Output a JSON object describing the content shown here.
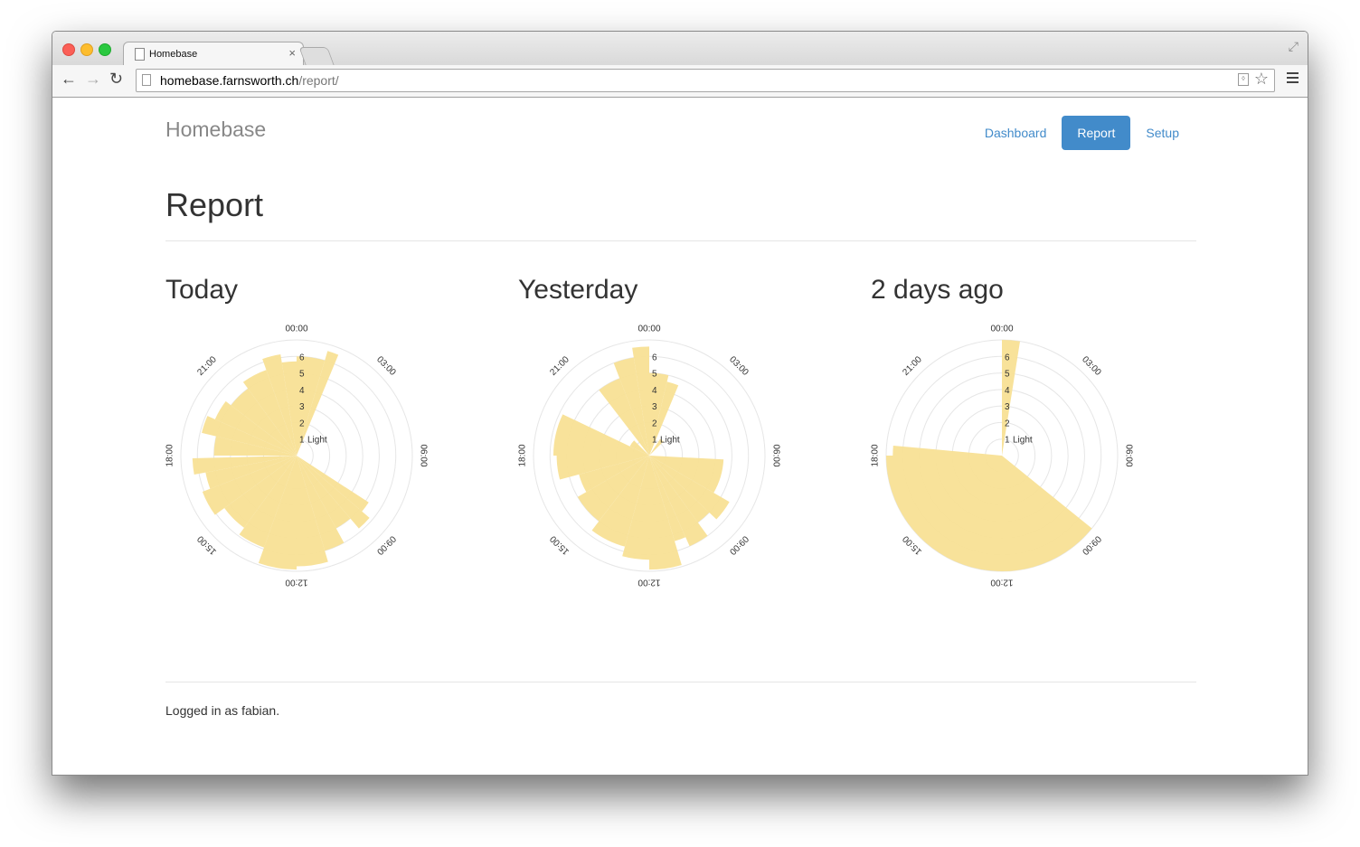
{
  "browser": {
    "tab_title": "Homebase",
    "url_host": "homebase.farnsworth.ch",
    "url_path": "/report/"
  },
  "brand": "Homebase",
  "nav": {
    "items": [
      {
        "label": "Dashboard",
        "active": false
      },
      {
        "label": "Report",
        "active": true
      },
      {
        "label": "Setup",
        "active": false
      }
    ]
  },
  "page_title": "Report",
  "footer": "Logged in as fabian.",
  "colors": {
    "accent": "#428bca",
    "wedge": "#f8e095"
  },
  "chart_data": [
    {
      "type": "polar-area",
      "title": "Today",
      "angle_labels": [
        "00:00",
        "03:00",
        "06:00",
        "09:00",
        "12:00",
        "15:00",
        "18:00",
        "21:00"
      ],
      "radial_ticks": [
        "1",
        "2",
        "3",
        "4",
        "5",
        "6"
      ],
      "radial_range": [
        0,
        7
      ],
      "series_label": "Light",
      "series": [
        {
          "name": "Light",
          "start_hour": 0.0,
          "end_hour": 1.1,
          "value": 6.0
        },
        {
          "name": "Light",
          "start_hour": 1.1,
          "end_hour": 1.5,
          "value": 6.6
        },
        {
          "name": "Light",
          "start_hour": 8.2,
          "end_hour": 8.7,
          "value": 5.2
        },
        {
          "name": "Light",
          "start_hour": 8.7,
          "end_hour": 9.3,
          "value": 5.8
        },
        {
          "name": "Light",
          "start_hour": 9.3,
          "end_hour": 10.1,
          "value": 5.0
        },
        {
          "name": "Light",
          "start_hour": 10.1,
          "end_hour": 10.9,
          "value": 6.0
        },
        {
          "name": "Light",
          "start_hour": 10.9,
          "end_hour": 12.0,
          "value": 6.7
        },
        {
          "name": "Light",
          "start_hour": 12.0,
          "end_hour": 13.3,
          "value": 6.9
        },
        {
          "name": "Light",
          "start_hour": 13.3,
          "end_hour": 14.4,
          "value": 5.9
        },
        {
          "name": "Light",
          "start_hour": 14.4,
          "end_hour": 15.6,
          "value": 5.4
        },
        {
          "name": "Light",
          "start_hour": 15.6,
          "end_hour": 16.6,
          "value": 6.1
        },
        {
          "name": "Light",
          "start_hour": 16.6,
          "end_hour": 17.3,
          "value": 5.6
        },
        {
          "name": "Light",
          "start_hour": 17.3,
          "end_hour": 17.9,
          "value": 6.3
        },
        {
          "name": "Light",
          "start_hour": 18.0,
          "end_hour": 18.9,
          "value": 5.0
        },
        {
          "name": "Light",
          "start_hour": 18.9,
          "end_hour": 19.6,
          "value": 5.9
        },
        {
          "name": "Light",
          "start_hour": 19.6,
          "end_hour": 20.5,
          "value": 5.4
        },
        {
          "name": "Light",
          "start_hour": 20.5,
          "end_hour": 21.6,
          "value": 5.0
        },
        {
          "name": "Light",
          "start_hour": 21.6,
          "end_hour": 22.7,
          "value": 5.5
        },
        {
          "name": "Light",
          "start_hour": 22.7,
          "end_hour": 23.4,
          "value": 6.2
        },
        {
          "name": "Light",
          "start_hour": 23.4,
          "end_hour": 24.0,
          "value": 5.7
        }
      ]
    },
    {
      "type": "polar-area",
      "title": "Yesterday",
      "angle_labels": [
        "00:00",
        "03:00",
        "06:00",
        "09:00",
        "12:00",
        "15:00",
        "18:00",
        "21:00"
      ],
      "radial_ticks": [
        "1",
        "2",
        "3",
        "4",
        "5",
        "6"
      ],
      "radial_range": [
        0,
        7
      ],
      "series_label": "Light",
      "series": [
        {
          "name": "Light",
          "start_hour": 0.0,
          "end_hour": 0.9,
          "value": 5.0
        },
        {
          "name": "Light",
          "start_hour": 0.9,
          "end_hour": 1.5,
          "value": 4.6
        },
        {
          "name": "Light",
          "start_hour": 2.2,
          "end_hour": 3.0,
          "value": 1.2
        },
        {
          "name": "Light",
          "start_hour": 6.2,
          "end_hour": 8.0,
          "value": 4.5
        },
        {
          "name": "Light",
          "start_hour": 8.0,
          "end_hour": 8.9,
          "value": 5.6
        },
        {
          "name": "Light",
          "start_hour": 8.9,
          "end_hour": 9.6,
          "value": 5.0
        },
        {
          "name": "Light",
          "start_hour": 9.6,
          "end_hour": 10.4,
          "value": 6.0
        },
        {
          "name": "Light",
          "start_hour": 10.4,
          "end_hour": 10.9,
          "value": 5.4
        },
        {
          "name": "Light",
          "start_hour": 10.9,
          "end_hour": 12.0,
          "value": 6.9
        },
        {
          "name": "Light",
          "start_hour": 12.0,
          "end_hour": 13.0,
          "value": 6.3
        },
        {
          "name": "Light",
          "start_hour": 13.0,
          "end_hour": 14.5,
          "value": 5.7
        },
        {
          "name": "Light",
          "start_hour": 14.5,
          "end_hour": 16.0,
          "value": 5.0
        },
        {
          "name": "Light",
          "start_hour": 16.0,
          "end_hour": 17.0,
          "value": 4.4
        },
        {
          "name": "Light",
          "start_hour": 17.0,
          "end_hour": 18.0,
          "value": 5.6
        },
        {
          "name": "Light",
          "start_hour": 18.0,
          "end_hour": 19.7,
          "value": 5.8
        },
        {
          "name": "Light",
          "start_hour": 19.7,
          "end_hour": 21.0,
          "value": 1.3
        },
        {
          "name": "Light",
          "start_hour": 21.5,
          "end_hour": 22.6,
          "value": 5.0
        },
        {
          "name": "Light",
          "start_hour": 22.6,
          "end_hour": 23.4,
          "value": 6.0
        },
        {
          "name": "Light",
          "start_hour": 23.4,
          "end_hour": 24.0,
          "value": 6.6
        }
      ]
    },
    {
      "type": "polar-area",
      "title": "2 days ago",
      "angle_labels": [
        "00:00",
        "03:00",
        "06:00",
        "09:00",
        "12:00",
        "15:00",
        "18:00",
        "21:00"
      ],
      "radial_ticks": [
        "1",
        "2",
        "3",
        "4",
        "5",
        "6"
      ],
      "radial_range": [
        0,
        7
      ],
      "series_label": "Light",
      "series": [
        {
          "name": "Light",
          "start_hour": 0.0,
          "end_hour": 0.6,
          "value": 7.0
        },
        {
          "name": "Light",
          "start_hour": 8.6,
          "end_hour": 18.0,
          "value": 7.0
        },
        {
          "name": "Light",
          "start_hour": 18.0,
          "end_hour": 18.35,
          "value": 6.6
        }
      ]
    }
  ]
}
